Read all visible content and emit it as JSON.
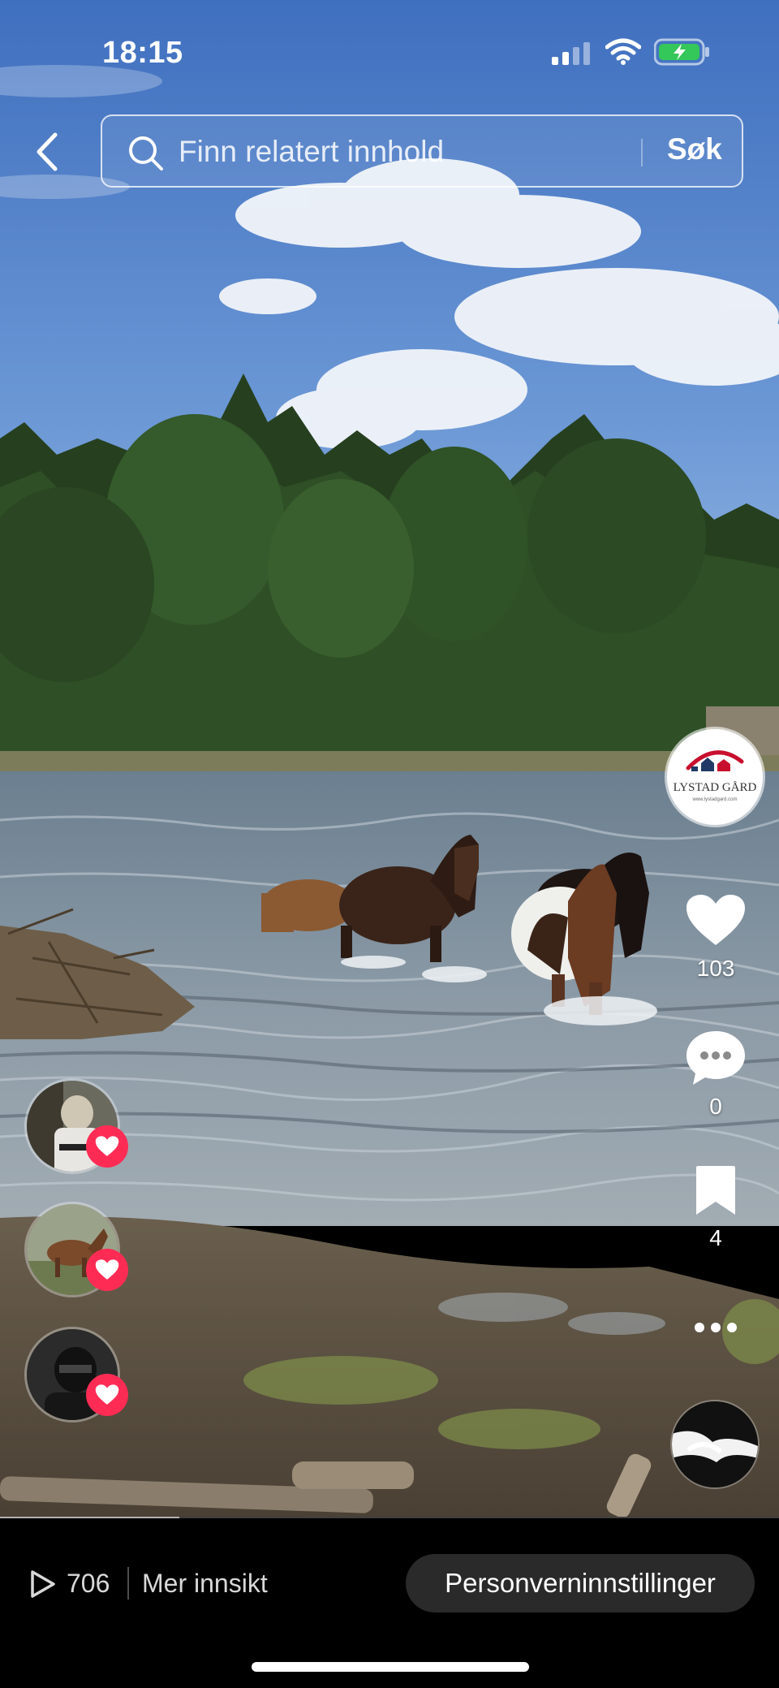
{
  "status_bar": {
    "time": "18:15"
  },
  "search": {
    "placeholder": "Finn relatert innhold",
    "submit_label": "Søk"
  },
  "creator": {
    "brand_name": "LYSTAD GÅRD",
    "brand_url": "www.lystadgard.com"
  },
  "actions": {
    "likes": "103",
    "comments": "0",
    "saves": "4"
  },
  "likers": [
    {
      "icon": "heart-icon"
    },
    {
      "icon": "heart-icon"
    },
    {
      "icon": "heart-icon"
    }
  ],
  "footer": {
    "views": "706",
    "insight_label": "Mer innsikt",
    "privacy_label": "Personverninnstillinger"
  },
  "playback": {
    "progress": 0.23
  },
  "colors": {
    "like_red": "#fe2c55",
    "bar_bg": "#000000",
    "pill_bg": "#2a2a2a"
  }
}
